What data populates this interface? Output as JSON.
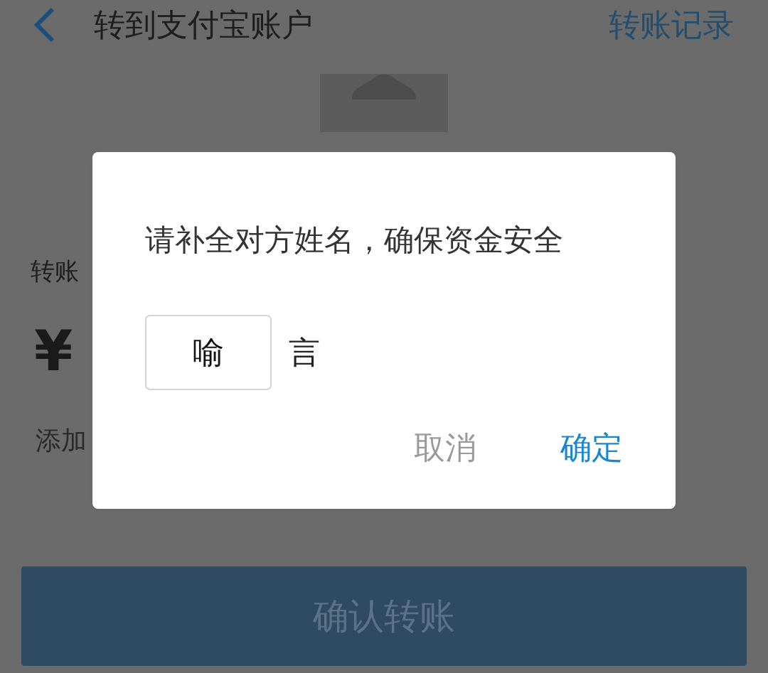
{
  "header": {
    "title": "转到支付宝账户",
    "action": "转账记录"
  },
  "form": {
    "amount_label": "转账",
    "currency": "¥",
    "note_label": "添加"
  },
  "submit_button": "确认转账",
  "dialog": {
    "message": "请补全对方姓名，确保资金安全",
    "name_value": "喻",
    "name_rest": "言",
    "buttons": [
      {
        "label": "取消",
        "kind": "cancel"
      },
      {
        "label": "确定",
        "kind": "confirm"
      }
    ]
  }
}
